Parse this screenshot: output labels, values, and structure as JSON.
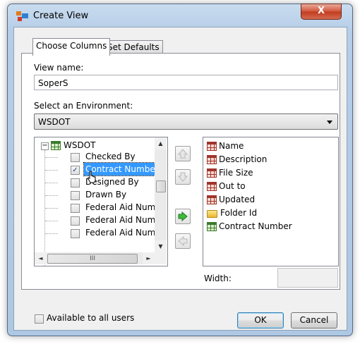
{
  "window": {
    "title": "Create View",
    "close_symbol": "X"
  },
  "tabs": [
    {
      "label": "Choose Columns"
    },
    {
      "label": "Set Defaults"
    }
  ],
  "view_name": {
    "label": "View name:",
    "value": "SoperS"
  },
  "environment": {
    "label": "Select an Environment:",
    "selected": "WSDOT"
  },
  "tree": {
    "root": {
      "label": "WSDOT",
      "expander": "−"
    },
    "items": [
      {
        "label": "Checked By",
        "checked": false
      },
      {
        "label": "Contract Number",
        "checked": true,
        "selected": true
      },
      {
        "label": "Designed By",
        "checked": false
      },
      {
        "label": "Drawn By",
        "checked": false
      },
      {
        "label": "Federal Aid Numb",
        "checked": false
      },
      {
        "label": "Federal Aid Numb",
        "checked": false
      },
      {
        "label": "Federal Aid Numb",
        "checked": false
      }
    ],
    "hscroll_grip": "III",
    "check_mark": "✓"
  },
  "selected_columns": [
    {
      "label": "Name",
      "icon": "table-red-icon"
    },
    {
      "label": "Description",
      "icon": "table-red-icon"
    },
    {
      "label": "File Size",
      "icon": "table-red-icon"
    },
    {
      "label": "Out to",
      "icon": "table-red-icon"
    },
    {
      "label": "Updated",
      "icon": "table-red-icon"
    },
    {
      "label": "Folder Id",
      "icon": "folder-icon"
    },
    {
      "label": "Contract Number",
      "icon": "table-green-icon"
    }
  ],
  "width": {
    "label": "Width:",
    "value": ""
  },
  "available_to_all": {
    "label": "Available to all users",
    "checked": false
  },
  "buttons": {
    "ok": "OK",
    "cancel": "Cancel"
  },
  "colors": {
    "selection": "#3399ff",
    "add_arrow": "#2fa82f",
    "disabled_arrow": "#b8b8b8"
  }
}
